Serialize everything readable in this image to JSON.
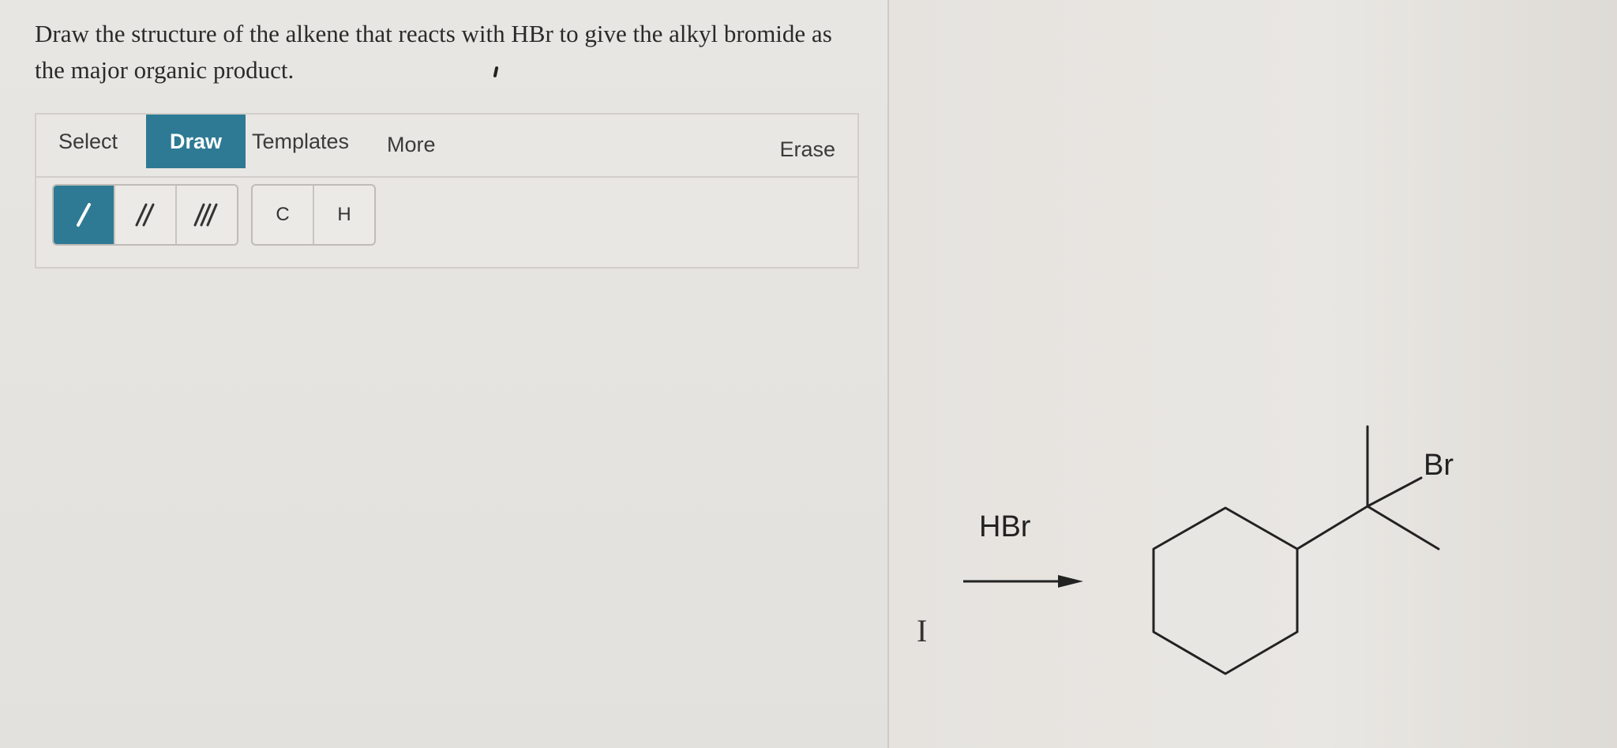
{
  "question": {
    "text": "Draw the structure of the alkene that reacts with HBr to give the alkyl bromide as the major organic product."
  },
  "toolbar": {
    "select_label": "Select",
    "draw_label": "Draw",
    "templates_label": "Templates",
    "more_label": "More",
    "erase_label": "Erase",
    "active_tab": "Draw"
  },
  "tools": {
    "bonds": [
      "single-bond-icon",
      "double-bond-icon",
      "triple-bond-icon"
    ],
    "atoms": [
      "C",
      "H"
    ],
    "active_tool": "single-bond"
  },
  "reaction": {
    "reagent": "HBr",
    "product_substituent": "Br"
  },
  "colors": {
    "accent": "#2e7a94",
    "background": "#e6e3df"
  }
}
